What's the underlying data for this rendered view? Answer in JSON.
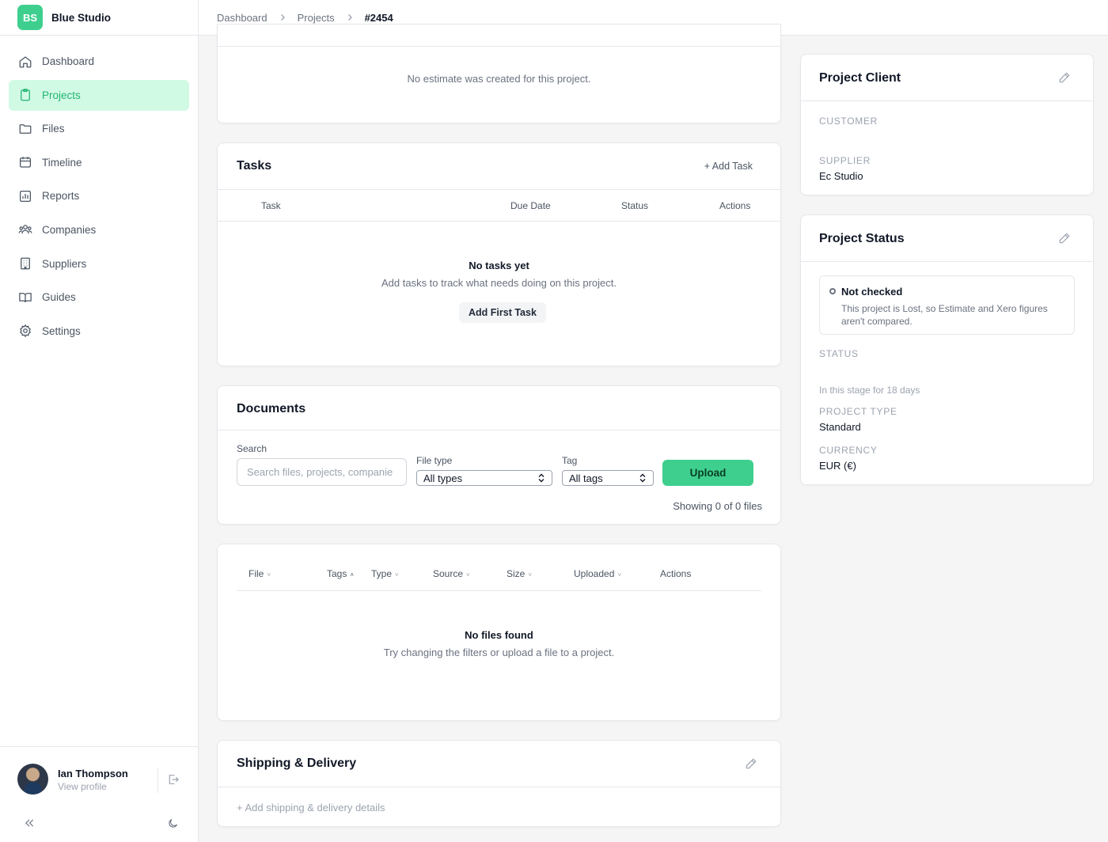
{
  "brand": {
    "initials": "BS",
    "name": "Blue Studio"
  },
  "nav": [
    {
      "label": "Dashboard",
      "icon": "home-icon",
      "active": false
    },
    {
      "label": "Projects",
      "icon": "clipboard-icon",
      "active": true
    },
    {
      "label": "Files",
      "icon": "folder-icon",
      "active": false
    },
    {
      "label": "Timeline",
      "icon": "calendar-icon",
      "active": false
    },
    {
      "label": "Reports",
      "icon": "bar-chart-icon",
      "active": false
    },
    {
      "label": "Companies",
      "icon": "users-icon",
      "active": false
    },
    {
      "label": "Suppliers",
      "icon": "building-icon",
      "active": false
    },
    {
      "label": "Guides",
      "icon": "book-icon",
      "active": false
    },
    {
      "label": "Settings",
      "icon": "gear-icon",
      "active": false
    }
  ],
  "user": {
    "name": "Ian Thompson",
    "link": "View profile"
  },
  "breadcrumb": {
    "items": [
      "Dashboard",
      "Projects"
    ],
    "current": "#2454"
  },
  "estimate": {
    "empty_text": "No estimate was created for this project."
  },
  "tasks": {
    "title": "Tasks",
    "add_label": "+ Add Task",
    "columns": [
      "Task",
      "Due Date",
      "Status",
      "Actions"
    ],
    "empty_title": "No tasks yet",
    "empty_text": "Add tasks to track what needs doing on this project.",
    "first_button": "Add First Task"
  },
  "documents": {
    "title": "Documents",
    "search_label": "Search",
    "search_placeholder": "Search files, projects, companie",
    "filetype_label": "File type",
    "filetype_value": "All types",
    "tag_label": "Tag",
    "tag_value": "All tags",
    "upload_label": "Upload",
    "showing": "Showing 0 of 0 files"
  },
  "files_table": {
    "columns": [
      {
        "label": "File",
        "sort": "˅"
      },
      {
        "label": "Tags",
        "sort": "˄"
      },
      {
        "label": "Type",
        "sort": "˅"
      },
      {
        "label": "Source",
        "sort": "˅"
      },
      {
        "label": "Size",
        "sort": "˅"
      },
      {
        "label": "Uploaded",
        "sort": "˅"
      },
      {
        "label": "Actions",
        "sort": ""
      }
    ],
    "empty_title": "No files found",
    "empty_text": "Try changing the filters or upload a file to a project."
  },
  "shipping": {
    "title": "Shipping & Delivery",
    "add_label": "+ Add shipping & delivery details"
  },
  "client": {
    "title": "Project Client",
    "customer_label": "CUSTOMER",
    "customer_value": "",
    "supplier_label": "SUPPLIER",
    "supplier_value": "Ec Studio"
  },
  "status": {
    "title": "Project Status",
    "check_title": "Not checked",
    "check_text": "This project is Lost, so Estimate and Xero figures aren't compared.",
    "status_label": "STATUS",
    "stage_text": "In this stage for 18 days",
    "type_label": "PROJECT TYPE",
    "type_value": "Standard",
    "currency_label": "CURRENCY",
    "currency_value": "EUR (€)"
  },
  "colors": {
    "accent": "#3ecf8e",
    "accent_light": "#d1fae5",
    "accent_text": "#22b573"
  }
}
